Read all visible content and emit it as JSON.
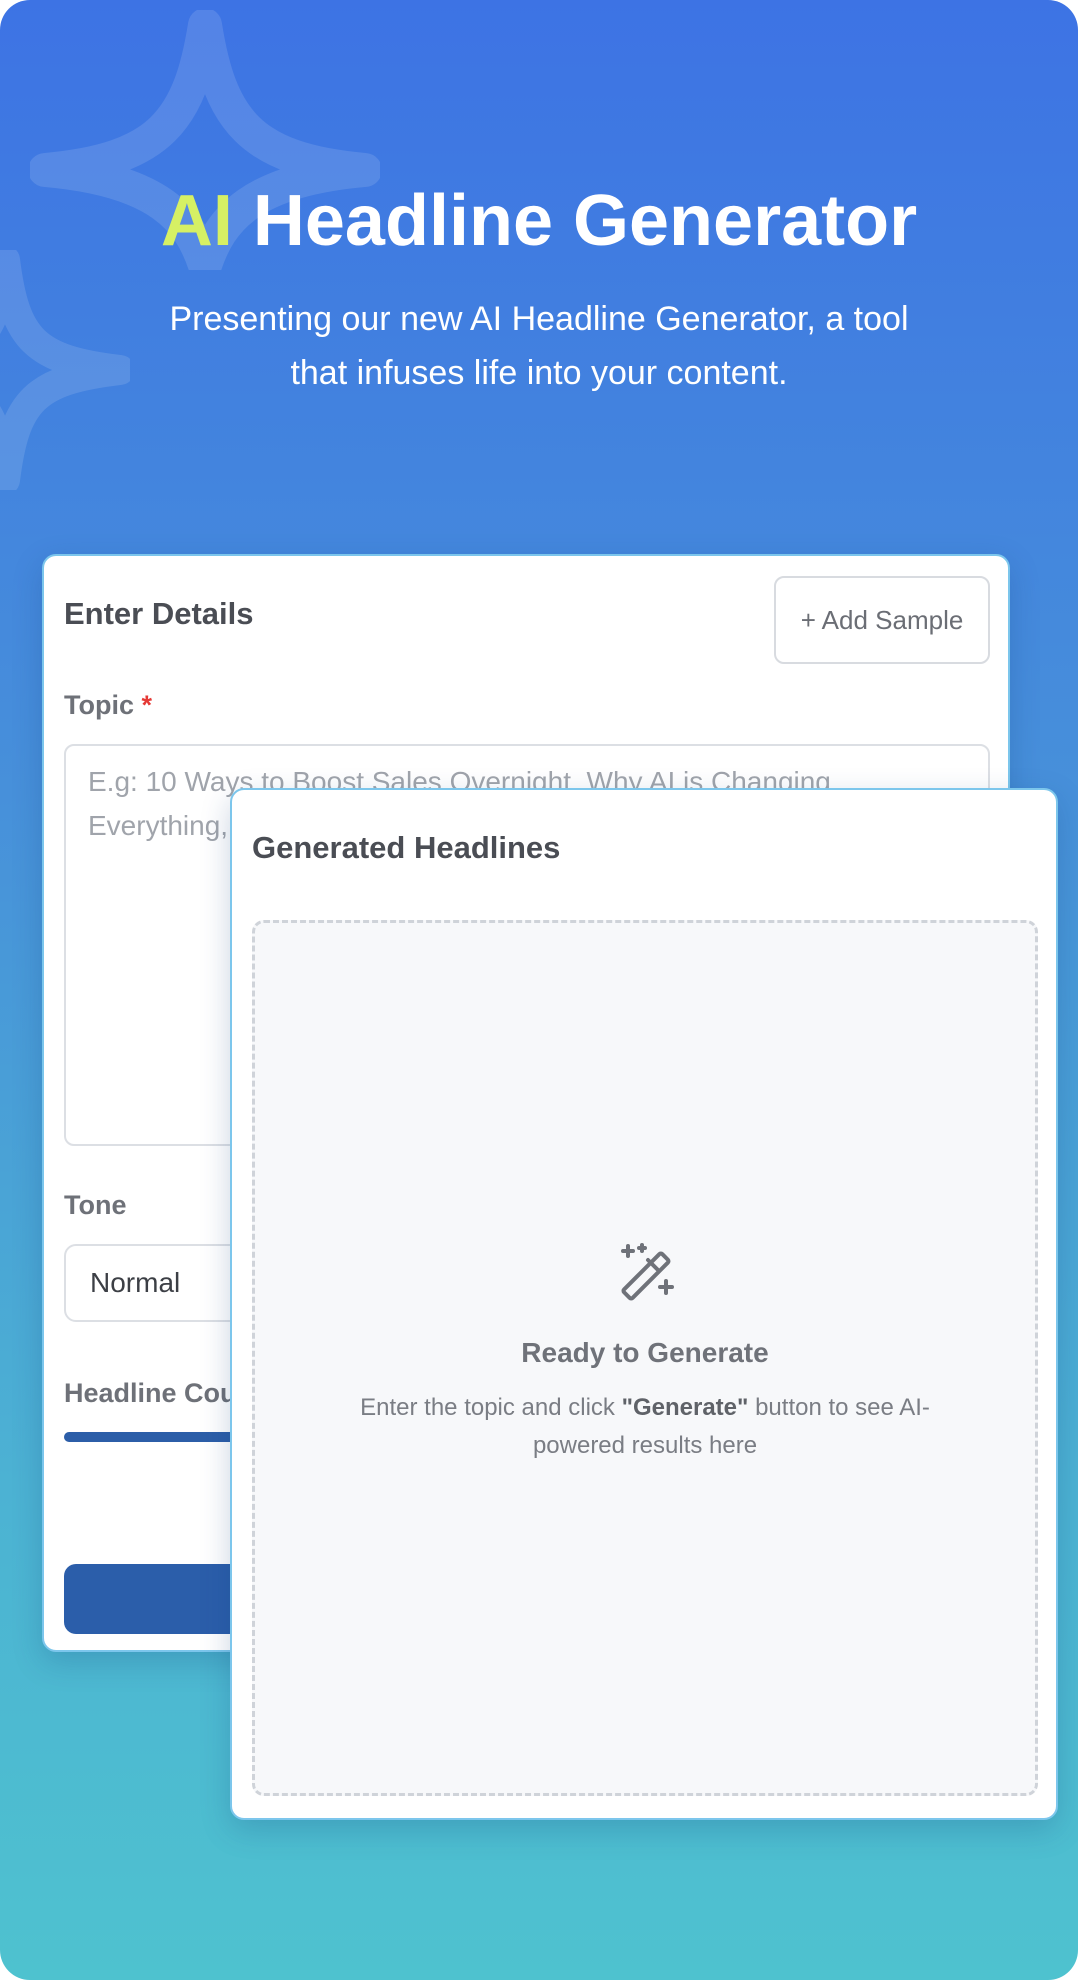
{
  "colors": {
    "background_top": "#3d73e4",
    "background_bottom": "#4ec2cf",
    "accent": "#d6f064",
    "primary_button": "#2b5eaa",
    "required_marker": "#e53935"
  },
  "hero": {
    "title_accent": "AI",
    "title_rest": " Headline Generator",
    "subtitle": "Presenting our new AI Headline Generator, a tool that infuses life into your content."
  },
  "details_card": {
    "title": "Enter Details",
    "add_sample_label": "+ Add Sample",
    "topic": {
      "label": "Topic",
      "required_mark": "*",
      "placeholder": "E.g: 10 Ways to Boost Sales Overnight, Why AI is Changing Everything, 5 Simple Habits That Make You More Productive."
    },
    "tone": {
      "label": "Tone",
      "selected": "Normal"
    },
    "headline_count": {
      "label": "Headline Count",
      "level_fraction": 0.6
    }
  },
  "results_card": {
    "title": "Generated Headlines",
    "empty_icon": "magic-wand-icon",
    "empty_title": "Ready to Generate",
    "empty_desc_before": "Enter the topic and click ",
    "empty_desc_bold": "\"Generate\"",
    "empty_desc_after": " button to see AI-powered results here"
  }
}
